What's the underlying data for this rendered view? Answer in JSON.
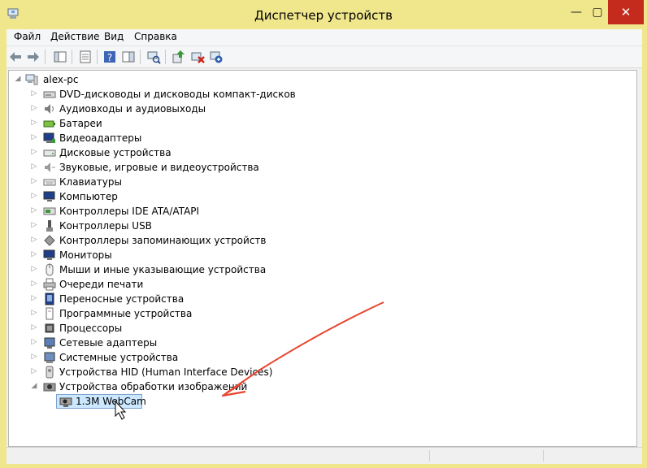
{
  "window": {
    "title": "Диспетчер устройств",
    "minimize_glyph": "—",
    "maximize_glyph": "▢",
    "close_glyph": "✕",
    "title_bg": "#f0e68c",
    "close_bg": "#c42b1c"
  },
  "menu": {
    "items": [
      "Файл",
      "Действие",
      "Вид",
      "Справка"
    ]
  },
  "toolbar": {
    "buttons": [
      "back-icon",
      "forward-icon",
      "console-tree-icon",
      "properties-icon",
      "help-icon",
      "action-pane-icon",
      "scan-hardware-icon",
      "update-driver-icon",
      "uninstall-device-icon",
      "disable-device-icon"
    ]
  },
  "tree": {
    "root": {
      "label": "alex-pc",
      "icon": "computer-icon"
    },
    "categories": [
      {
        "label": "DVD-дисководы и дисководы компакт-дисков",
        "icon": "dvd-drive-icon"
      },
      {
        "label": "Аудиовходы и аудиовыходы",
        "icon": "speaker-icon"
      },
      {
        "label": "Батареи",
        "icon": "battery-icon"
      },
      {
        "label": "Видеоадаптеры",
        "icon": "display-adapter-icon"
      },
      {
        "label": "Дисковые устройства",
        "icon": "disk-drive-icon"
      },
      {
        "label": "Звуковые, игровые и видеоустройства",
        "icon": "sound-icon"
      },
      {
        "label": "Клавиатуры",
        "icon": "keyboard-icon"
      },
      {
        "label": "Компьютер",
        "icon": "monitor-icon"
      },
      {
        "label": "Контроллеры IDE ATA/ATAPI",
        "icon": "ide-controller-icon"
      },
      {
        "label": "Контроллеры USB",
        "icon": "usb-icon"
      },
      {
        "label": "Контроллеры запоминающих устройств",
        "icon": "storage-controller-icon"
      },
      {
        "label": "Мониторы",
        "icon": "monitor-icon"
      },
      {
        "label": "Мыши и иные указывающие устройства",
        "icon": "mouse-icon"
      },
      {
        "label": "Очереди печати",
        "icon": "printer-icon"
      },
      {
        "label": "Переносные устройства",
        "icon": "portable-device-icon"
      },
      {
        "label": "Программные устройства",
        "icon": "software-device-icon"
      },
      {
        "label": "Процессоры",
        "icon": "processor-icon"
      },
      {
        "label": "Сетевые адаптеры",
        "icon": "network-adapter-icon"
      },
      {
        "label": "Системные устройства",
        "icon": "system-device-icon"
      },
      {
        "label": "Устройства HID (Human Interface Devices)",
        "icon": "hid-icon"
      },
      {
        "label": "Устройства обработки изображений",
        "icon": "camera-icon",
        "expanded": true,
        "children": [
          {
            "label": "1.3M WebCam",
            "icon": "webcam-icon",
            "selected": true
          }
        ]
      }
    ],
    "collapsed_glyph": "▷",
    "expanded_glyph": "◢"
  },
  "annotation": {
    "color": "#e8452f",
    "icon": "red-arrow"
  },
  "cursor": {
    "icon": "mouse-pointer-icon"
  }
}
